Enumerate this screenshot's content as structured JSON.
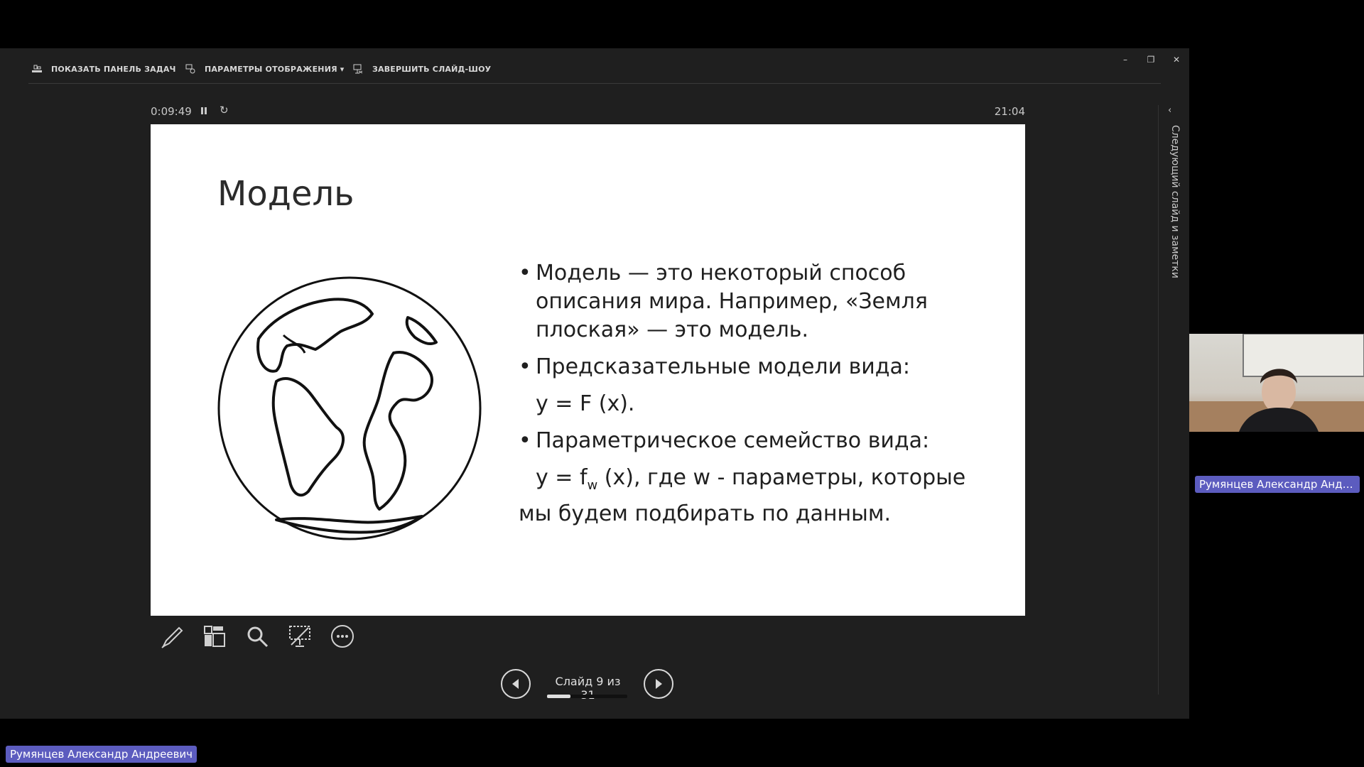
{
  "toolbar": {
    "show_taskbar": "ПОКАЗАТЬ ПАНЕЛЬ ЗАДАЧ",
    "display_settings": "ПАРАМЕТРЫ ОТОБРАЖЕНИЯ ▾",
    "end_show": "ЗАВЕРШИТЬ СЛАЙД-ШОУ"
  },
  "window": {
    "minimize": "–",
    "restore": "❐",
    "close": "✕"
  },
  "timer": {
    "elapsed": "0:09:49",
    "clock": "21:04"
  },
  "slide": {
    "title": "Модель",
    "bullets": [
      "Модель — это некоторый способ описания мира. Например, «Земля плоская» — это модель.",
      "Предсказательные модели вида:",
      "Параметрическое семейство вида:"
    ],
    "formula1": "y = F (x).",
    "formula2_pre": "y = f",
    "formula2_sub": "w",
    "formula2_post": " (x), где w - параметры, которые",
    "formula2_tail": "мы будем подбирать по данным."
  },
  "navigation": {
    "counter": "Слайд 9 из 31",
    "progress": 0.29
  },
  "side_panel": {
    "label": "Следующий слайд и заметки",
    "toggle": "‹"
  },
  "participants": {
    "video_name": "Румянцев Александр Андреевич",
    "presenter_name": "Румянцев Александр Андреевич"
  },
  "colors": {
    "name_tag": "#5c5cbf",
    "background": "#1f1f1f"
  }
}
